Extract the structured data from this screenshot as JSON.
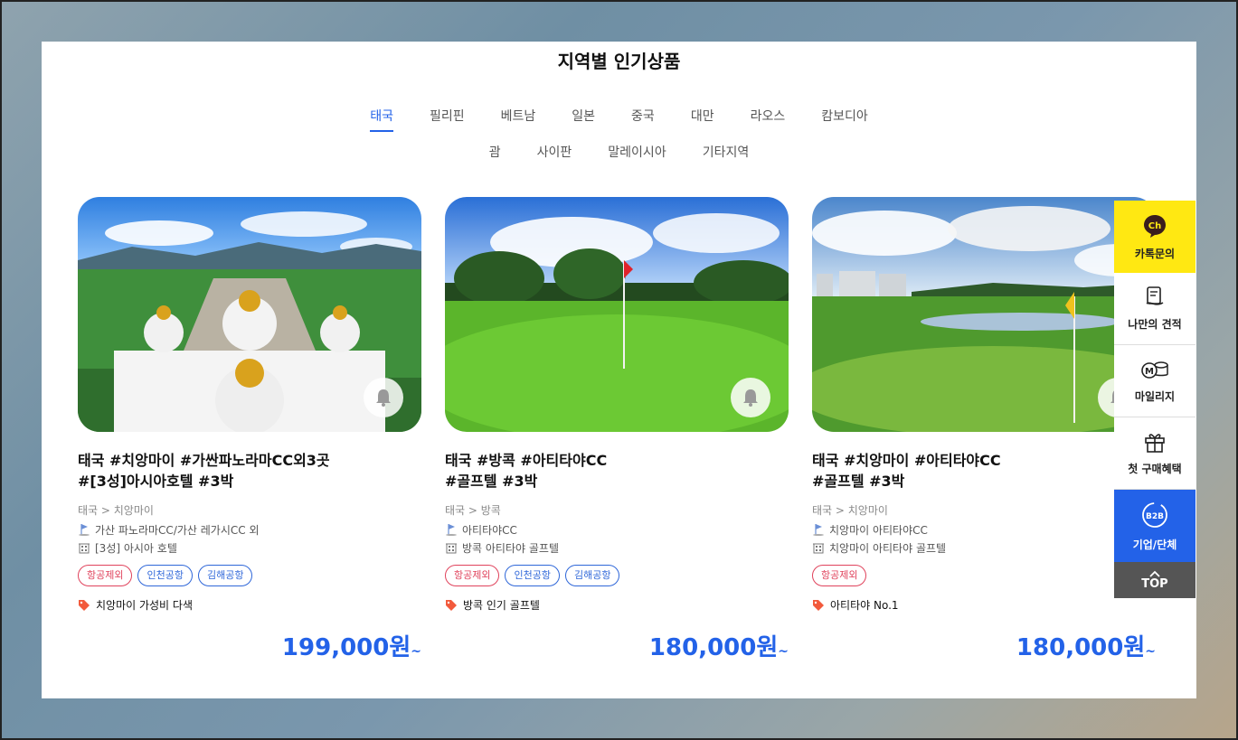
{
  "section_title": "지역별 인기상품",
  "tabs_row1": [
    "태국",
    "필리핀",
    "베트남",
    "일본",
    "중국",
    "대만",
    "라오스",
    "캄보디아"
  ],
  "tabs_row2": [
    "괌",
    "사이판",
    "말레이시아",
    "기타지역"
  ],
  "active_tab": "태국",
  "products": [
    {
      "title_line1": "태국 #치앙마이 #가싼파노라마CC외3곳",
      "title_line2": "#[3성]아시아호텔 #3박",
      "breadcrumb": "태국 > 치앙마이",
      "golf": "가산 파노라마CC/가산 레가시CC 외",
      "hotel": "[3성] 아시아 호텔",
      "tags": [
        {
          "label": "항공제외",
          "color": "red"
        },
        {
          "label": "인천공항",
          "color": "blue"
        },
        {
          "label": "김해공항",
          "color": "blue"
        }
      ],
      "promo": "치앙마이 가성비 다색",
      "price": "199,000원",
      "price_suffix": "~"
    },
    {
      "title_line1": "태국 #방콕 #아티타야CC",
      "title_line2": "#골프텔 #3박",
      "breadcrumb": "태국 > 방콕",
      "golf": "아티타야CC",
      "hotel": "방콕 아티타야 골프텔",
      "tags": [
        {
          "label": "항공제외",
          "color": "red"
        },
        {
          "label": "인천공항",
          "color": "blue"
        },
        {
          "label": "김해공항",
          "color": "blue"
        }
      ],
      "promo": "방콕 인기 골프텔",
      "price": "180,000원",
      "price_suffix": "~"
    },
    {
      "title_line1": "태국 #치앙마이 #아티타야CC",
      "title_line2": "#골프텔 #3박",
      "breadcrumb": "태국 > 치앙마이",
      "golf": "치앙마이 아티타야CC",
      "hotel": "치앙마이 아티타야 골프텔",
      "tags": [
        {
          "label": "항공제외",
          "color": "red"
        }
      ],
      "promo": "아티타야 No.1",
      "price": "180,000원",
      "price_suffix": "~"
    }
  ],
  "side_menu": {
    "kakao": "카톡문의",
    "kakao_icon_text": "Ch",
    "estimate": "나만의 견적",
    "mileage": "마일리지",
    "first_benefit": "첫 구매혜택",
    "b2b_icon_text": "B2B",
    "b2b": "기업/단체",
    "top": "TOP"
  },
  "colors": {
    "accent": "#2362e8",
    "tag_red": "#e0435c",
    "kakao": "#ffe812"
  }
}
